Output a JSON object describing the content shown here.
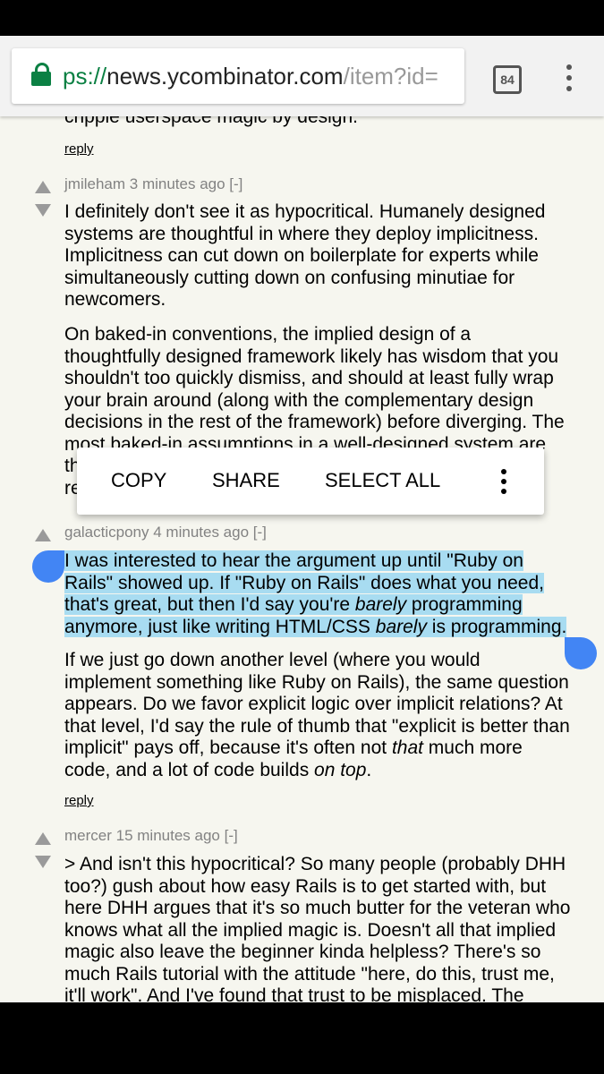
{
  "browser": {
    "url_scheme": "ps://",
    "url_host": "news.ycombinator.com",
    "url_path": "/item?id=",
    "tab_count": "84"
  },
  "top": {
    "partial_text": "cripple userspace magic by design.",
    "reply": "reply"
  },
  "comments": [
    {
      "user": "jmileham",
      "age": "3 minutes ago",
      "toggle": "[-]",
      "para1": [
        "I definitely don't see it as hypocritical. Humanely designed",
        "systems are thoughtful in where they deploy implicitness.",
        "Implicitness can cut down on boilerplate for experts while",
        "simultaneously cutting down on confusing minutiae for",
        "newcomers."
      ],
      "para2": [
        "On baked-in conventions, the implied design of a",
        "thoughtfully designed framework likely has wisdom that you",
        "shouldn't too quickly dismiss, and should at least fully wrap",
        "your brain around (along with the complementary design",
        "decisions in the rest of the framework) before diverging. The",
        "most baked-in assumptions in a well-designed system are",
        "th",
        "re"
      ]
    },
    {
      "user": "galacticpony",
      "age": "4 minutes ago",
      "toggle": "[-]",
      "sel1": "I was interested to hear the argument up until \"Ruby on",
      "sel2": "Rails\" showed up. If \"Ruby on Rails\" does what you need,",
      "sel3a": "that's great, but then I'd say you're ",
      "sel3b": "barely",
      "sel3c": " programming",
      "sel4a": "anymore, just like writing HTML/CSS ",
      "sel4b": "barely",
      "sel4c": " is programming.",
      "p2_1": "If we just go down another level (where you would",
      "p2_2": "implement something like Ruby on Rails), the same question",
      "p2_3": "appears. Do we favor explicit logic over implicit relations? At",
      "p2_4": "that level, I'd say the rule of thumb that \"explicit is better than",
      "p2_5a": "implicit\" pays off, because it's often not ",
      "p2_5b": "that",
      "p2_5c": " much more",
      "p2_6a": "code, and a lot of code builds ",
      "p2_6b": "on top",
      "p2_6c": ".",
      "reply": "reply"
    },
    {
      "user": "mercer",
      "age": "15 minutes ago",
      "toggle": "[-]",
      "lines": [
        "> And isn't this hypocritical? So many people (probably DHH",
        "too?) gush about how easy Rails is to get started with, but",
        "here DHH argues that it's so much butter for the veteran who",
        "knows what all the implied magic is. Doesn't all that implied",
        "magic also leave the beginner kinda helpless? There's so",
        "much Rails tutorial with the attitude \"here, do this, trust me,",
        "it'll work\". And I've found that trust to be misplaced. The"
      ]
    }
  ],
  "context_menu": {
    "copy": "COPY",
    "share": "SHARE",
    "select_all": "SELECT ALL"
  }
}
